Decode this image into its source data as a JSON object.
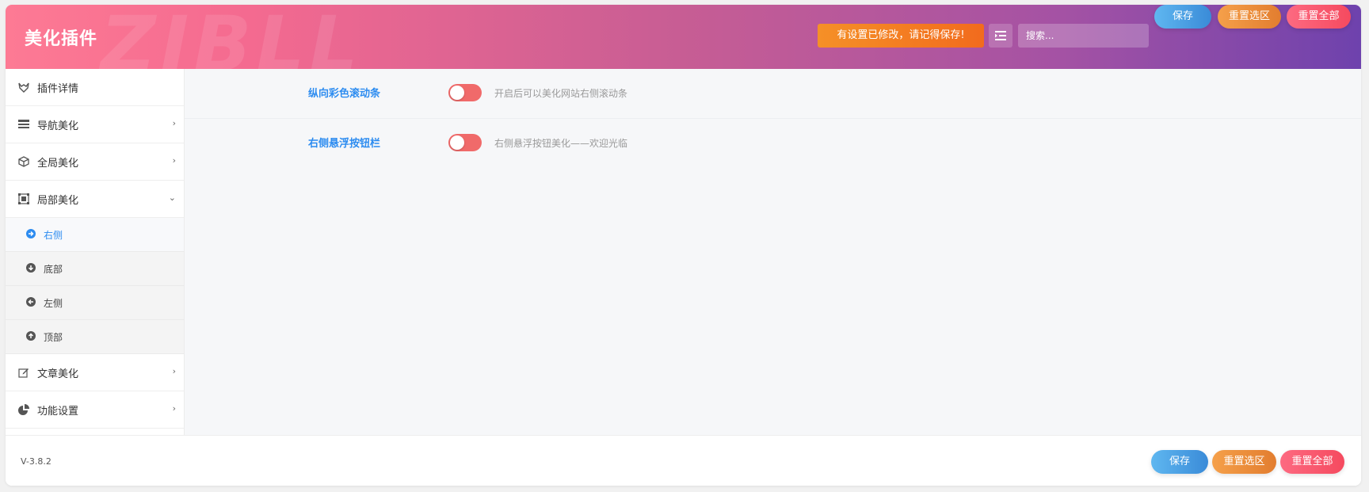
{
  "header": {
    "brand": "美化插件",
    "watermark": "ZIBLL",
    "notice": "有设置已修改，请记得保存!",
    "search_placeholder": "搜索...",
    "save_label": "保存",
    "reset_section_label": "重置选区",
    "reset_all_label": "重置全部"
  },
  "sidebar": {
    "items": [
      {
        "label": "插件详情",
        "icon": "fox-icon"
      },
      {
        "label": "导航美化",
        "icon": "navbar-icon"
      },
      {
        "label": "全局美化",
        "icon": "cube-icon"
      },
      {
        "label": "局部美化",
        "icon": "object-group-icon"
      }
    ],
    "subitems": [
      {
        "label": "右侧",
        "icon": "arrow-circle-right-icon",
        "active": true
      },
      {
        "label": "底部",
        "icon": "arrow-circle-down-icon"
      },
      {
        "label": "左侧",
        "icon": "arrow-circle-left-icon"
      },
      {
        "label": "顶部",
        "icon": "arrow-circle-up-icon"
      }
    ],
    "items_after": [
      {
        "label": "文章美化",
        "icon": "edit-icon"
      },
      {
        "label": "功能设置",
        "icon": "pie-chart-icon"
      }
    ]
  },
  "fields": [
    {
      "title": "纵向彩色滚动条",
      "desc": "开启后可以美化网站右侧滚动条",
      "enabled": false
    },
    {
      "title": "右侧悬浮按钮栏",
      "desc": "右侧悬浮按钮美化——欢迎光临",
      "enabled": false
    }
  ],
  "footer": {
    "version": "V-3.8.2",
    "save_label": "保存",
    "reset_section_label": "重置选区",
    "reset_all_label": "重置全部"
  },
  "colors": {
    "accent": "#2d8cf0",
    "toggle_off": "#f06a6a",
    "notice": "#f2791f"
  }
}
